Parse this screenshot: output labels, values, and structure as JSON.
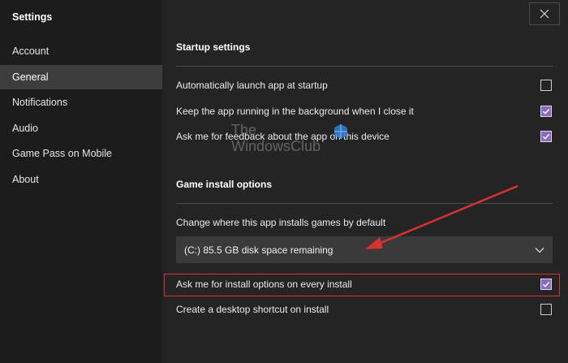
{
  "sidebar": {
    "title": "Settings",
    "items": [
      {
        "label": "Account",
        "active": false
      },
      {
        "label": "General",
        "active": true
      },
      {
        "label": "Notifications",
        "active": false
      },
      {
        "label": "Audio",
        "active": false
      },
      {
        "label": "Game Pass on Mobile",
        "active": false
      },
      {
        "label": "About",
        "active": false
      }
    ]
  },
  "main": {
    "close_icon": "close-icon",
    "startup": {
      "title": "Startup settings",
      "options": [
        {
          "label": "Automatically launch app at startup",
          "checked": false
        },
        {
          "label": "Keep the app running in the background when I close it",
          "checked": true
        },
        {
          "label": "Ask me for feedback about the app on this device",
          "checked": true
        }
      ]
    },
    "install": {
      "title": "Game install options",
      "location_label": "Change where this app installs games by default",
      "location_value": "(C:) 85.5 GB disk space remaining",
      "options": [
        {
          "label": "Ask me for install options on every install",
          "checked": true
        },
        {
          "label": "Create a desktop shortcut on install",
          "checked": false
        }
      ]
    }
  },
  "watermark": {
    "line1": "The",
    "line2": "WindowsClub"
  },
  "colors": {
    "accent": "#8a6bbe",
    "annotation": "#d93030",
    "sidebar_bg": "#1c1c1c",
    "main_bg": "#242424",
    "active_item": "#3d3d3d"
  }
}
